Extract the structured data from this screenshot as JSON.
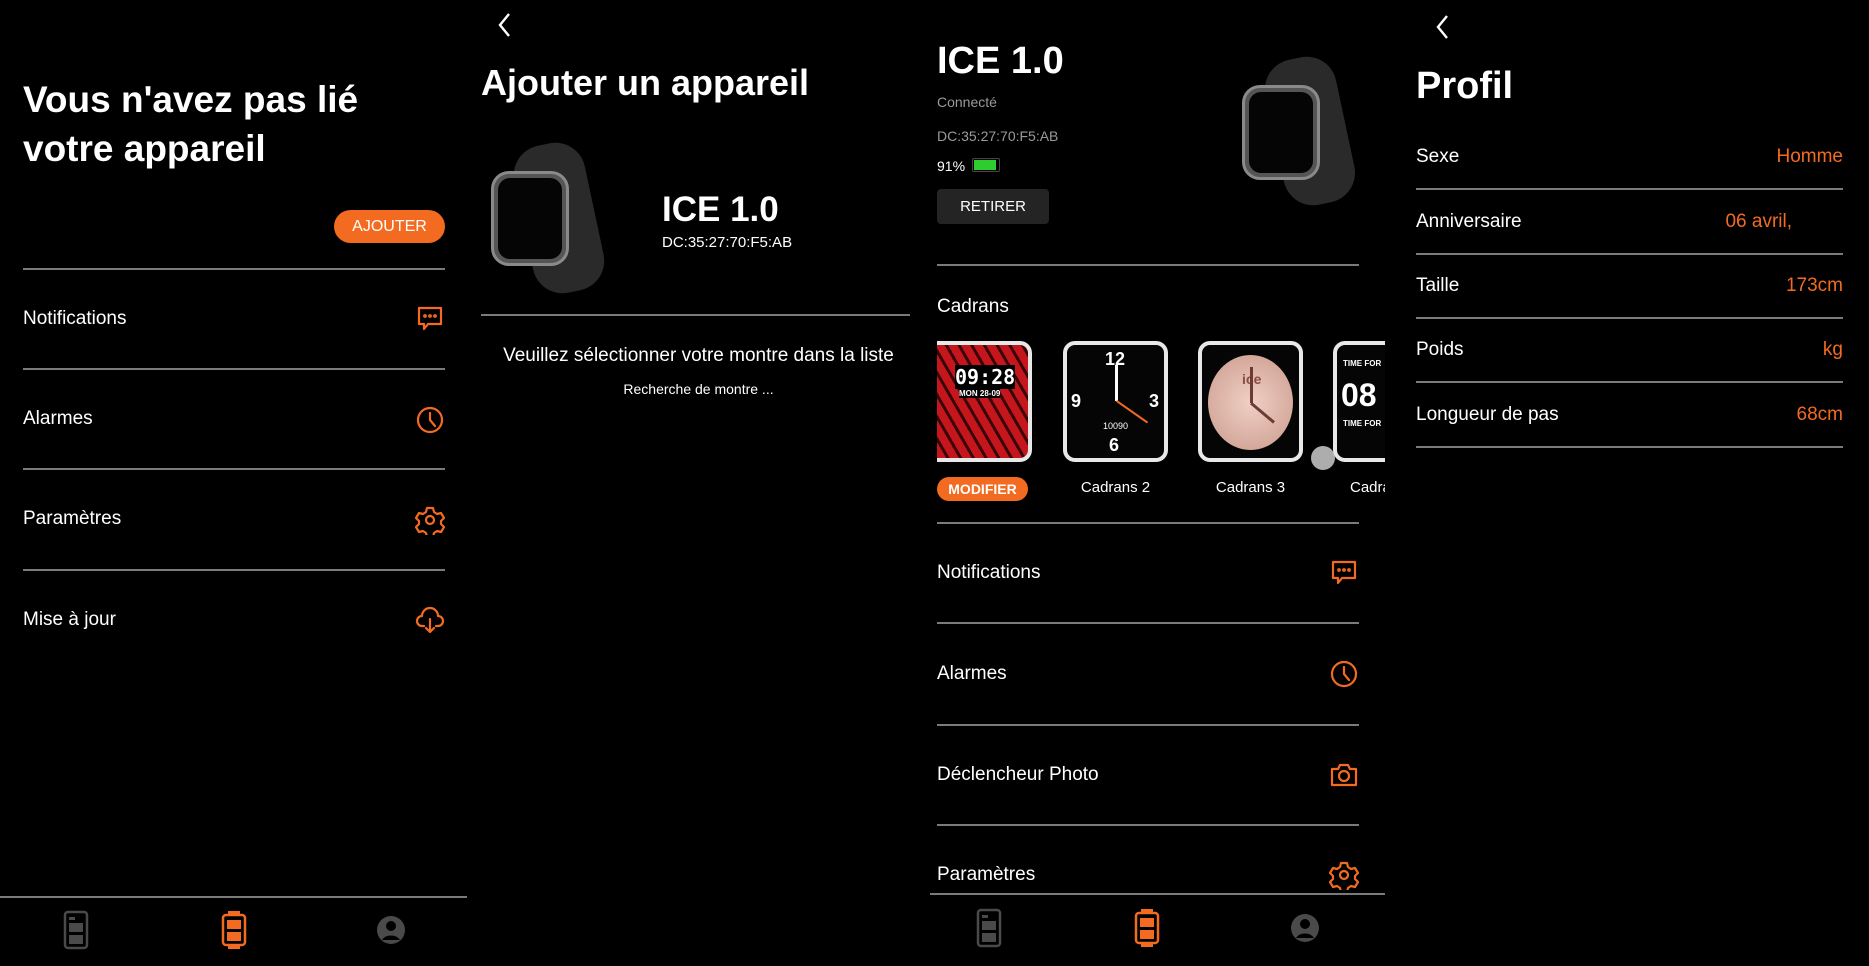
{
  "colors": {
    "accent": "#f26b21",
    "background": "#000000",
    "divider": "#7a7a7a",
    "battery": "#2ecc2e",
    "inactive_nav": "#4a4a4a"
  },
  "screen_unlinked": {
    "title_line1": "Vous n'avez pas lié",
    "title_line2": "votre appareil",
    "add_button": "AJOUTER",
    "menu": [
      {
        "label": "Notifications",
        "icon": "chat-bubble-icon"
      },
      {
        "label": "Alarmes",
        "icon": "clock-icon"
      },
      {
        "label": "Paramètres",
        "icon": "gear-icon"
      },
      {
        "label": "Mise à jour",
        "icon": "cloud-download-icon"
      }
    ]
  },
  "screen_add_device": {
    "title": "Ajouter un appareil",
    "device_name": "ICE 1.0",
    "device_mac": "DC:35:27:70:F5:AB",
    "instruction": "Veuillez sélectionner votre montre dans la liste",
    "searching": "Recherche de montre ..."
  },
  "screen_device": {
    "device_name": "ICE 1.0",
    "status": "Connecté",
    "device_mac": "DC:35:27:70:F5:AB",
    "battery": "91%",
    "battery_level": 0.91,
    "remove_button": "RETIRER",
    "dials_title": "Cadrans",
    "dials": [
      {
        "label": "MODIFIER",
        "time": "09:28",
        "date": "MON 28-09"
      },
      {
        "label": "Cadrans 2",
        "steps": "10090"
      },
      {
        "label": "Cadrans 3",
        "brand": "ice"
      },
      {
        "label": "Cadra",
        "time": "08",
        "text": "TIME FOR"
      }
    ],
    "menu": [
      {
        "label": "Notifications",
        "icon": "chat-bubble-icon"
      },
      {
        "label": "Alarmes",
        "icon": "clock-icon"
      },
      {
        "label": "Déclencheur Photo",
        "icon": "camera-icon"
      },
      {
        "label": "Paramètres",
        "icon": "gear-icon"
      }
    ]
  },
  "screen_profile": {
    "title": "Profil",
    "rows": [
      {
        "label": "Sexe",
        "value": "Homme"
      },
      {
        "label": "Anniversaire",
        "value": "06 avril,"
      },
      {
        "label": "Taille",
        "value": "173cm"
      },
      {
        "label": "Poids",
        "value": "kg"
      },
      {
        "label": "Longueur de pas",
        "value": "68cm"
      }
    ]
  },
  "bottom_nav": {
    "items": [
      "dashboard-icon",
      "watch-icon",
      "profile-icon"
    ],
    "active": 1
  },
  "watch_face": {
    "hours": [
      "12",
      "3",
      "6",
      "9"
    ]
  }
}
